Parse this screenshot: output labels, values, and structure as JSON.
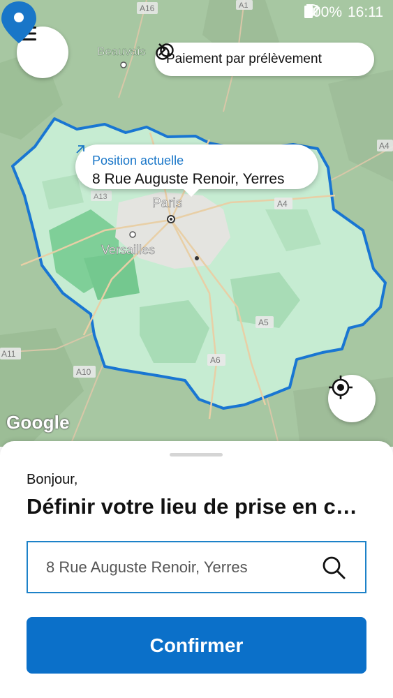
{
  "status_bar": {
    "battery": "100%",
    "time": "16:11"
  },
  "map": {
    "city_labels": [
      "Beauvais",
      "Paris",
      "Versailles"
    ],
    "road_labels": [
      "A16",
      "A1",
      "A4",
      "A4",
      "A5",
      "A6",
      "A10",
      "A11",
      "A13"
    ],
    "attribution": "Google"
  },
  "header": {
    "payment_label": "Paiement par prélèvement"
  },
  "callout": {
    "position_label": "Position actuelle",
    "address": "8 Rue Auguste Renoir, Yerres"
  },
  "sheet": {
    "greeting": "Bonjour,",
    "title": "Définir votre lieu de prise en charge",
    "search_value": "8 Rue Auguste Renoir, Yerres",
    "confirm_label": "Confirmer"
  },
  "colors": {
    "accent": "#0b70c9",
    "region_fill": "#c9efd6",
    "region_border": "#1976d2",
    "map_bg": "#a9c9a4"
  }
}
